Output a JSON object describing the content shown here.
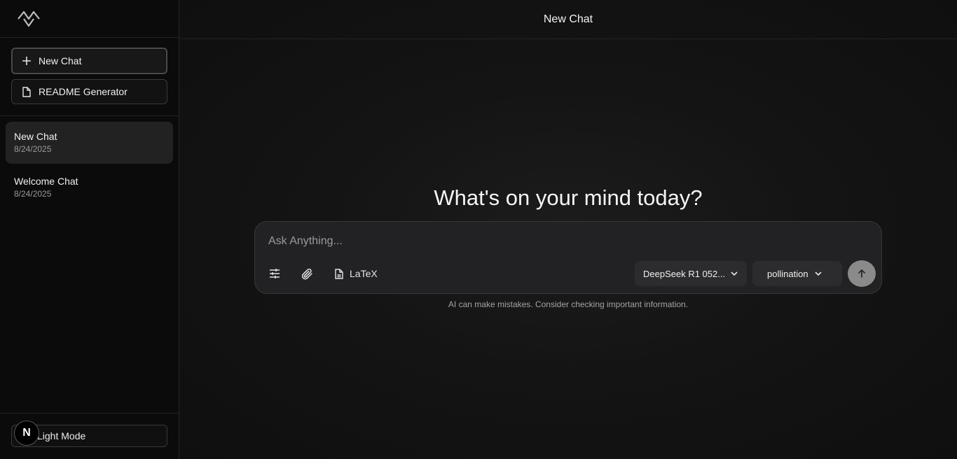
{
  "sidebar": {
    "new_chat_label": "New Chat",
    "readme_label": "README Generator",
    "chats": [
      {
        "title": "New Chat",
        "date": "8/24/2025"
      },
      {
        "title": "Welcome Chat",
        "date": "8/24/2025"
      }
    ],
    "mode_label": "Light Mode",
    "badge_letter": "N"
  },
  "header": {
    "title": "New Chat"
  },
  "main": {
    "headline": "What's on your mind today?",
    "input_placeholder": "Ask Anything...",
    "latex_label": "LaTeX",
    "model_select": "DeepSeek R1 052...",
    "provider_select": "pollination",
    "disclaimer": "AI can make mistakes. Consider checking important information."
  },
  "icons": {
    "logo": "logo-icon",
    "plus": "plus-icon",
    "file": "file-icon",
    "sliders": "sliders-icon",
    "paperclip": "paperclip-icon",
    "chevron": "chevron-down-icon",
    "send": "arrow-up-icon"
  },
  "colors": {
    "background": "#0f0f0f",
    "composer": "#222224",
    "send_button": "#8a8a8a"
  }
}
